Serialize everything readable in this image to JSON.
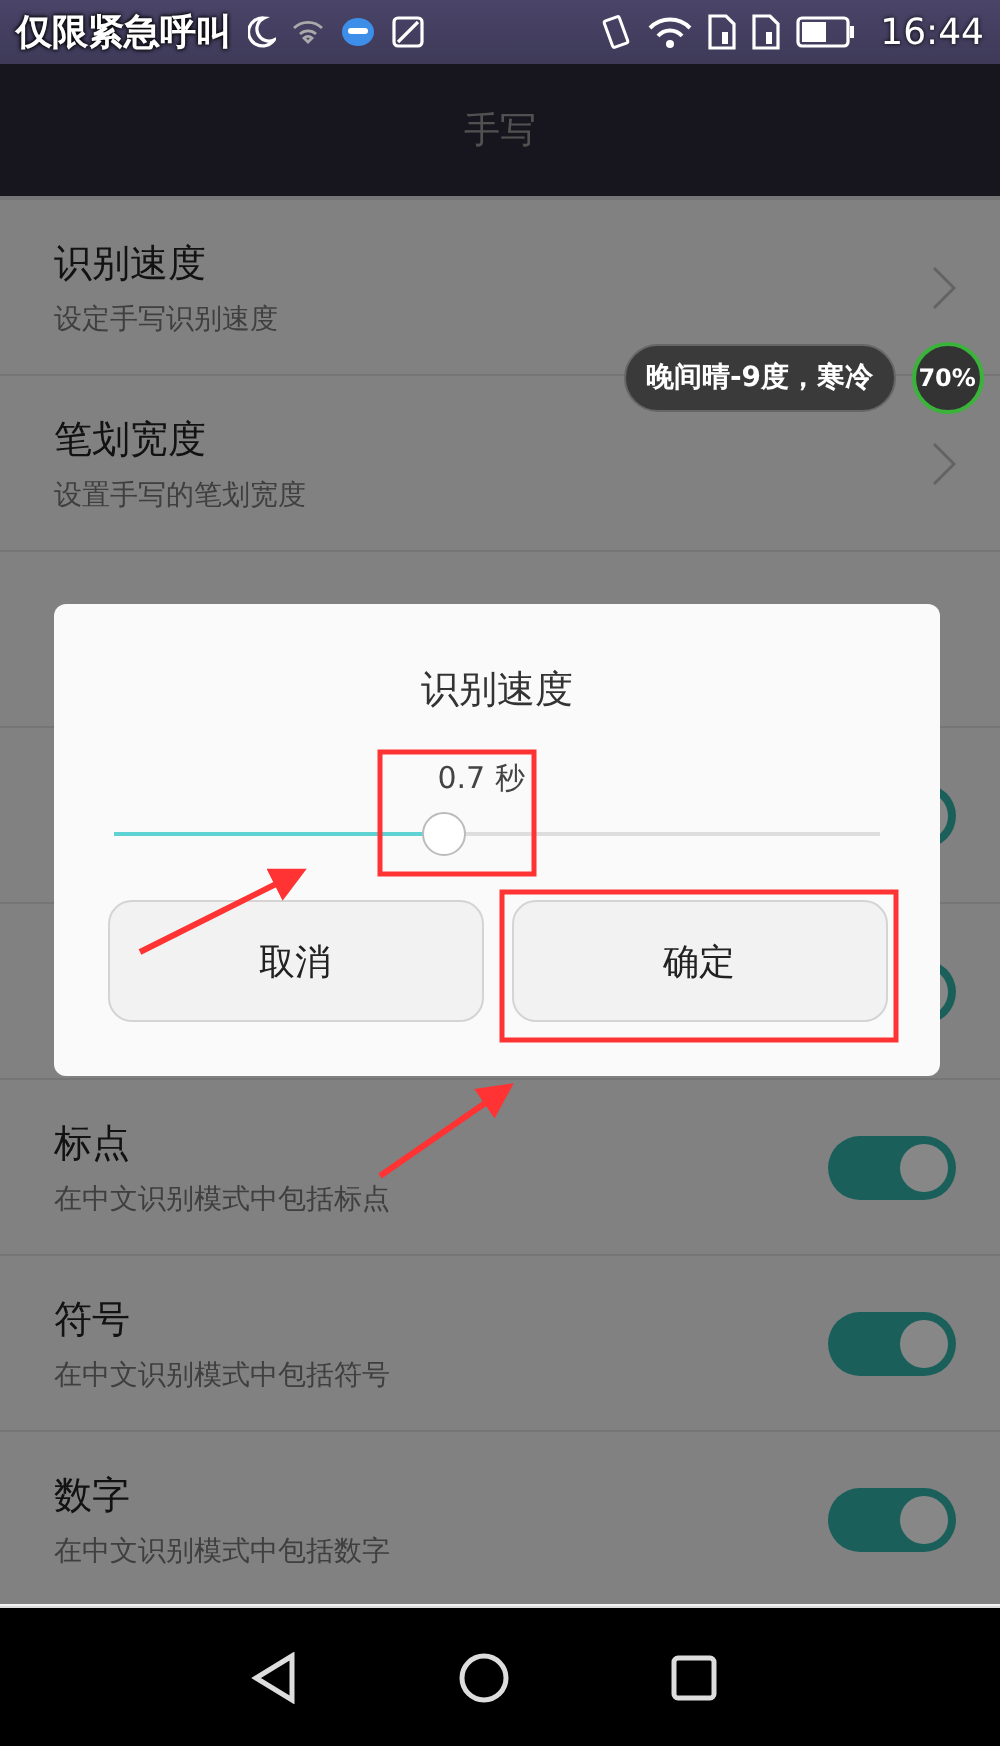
{
  "status_bar": {
    "carrier": "仅限紧急呼叫",
    "time": "16:44"
  },
  "title": "手写",
  "settings": [
    {
      "kind": "chevron",
      "title": "识别速度",
      "subtitle": "设定手写识别速度"
    },
    {
      "kind": "chevron",
      "title": "笔划宽度",
      "subtitle": "设置手写的笔划宽度"
    },
    {
      "kind": "plain"
    },
    {
      "kind": "toggle",
      "on": true
    },
    {
      "kind": "toggle",
      "on": true
    },
    {
      "kind": "toggle",
      "title": "标点",
      "subtitle": "在中文识别模式中包括标点",
      "on": true
    },
    {
      "kind": "toggle",
      "title": "符号",
      "subtitle": "在中文识别模式中包括符号",
      "on": true
    },
    {
      "kind": "toggle",
      "title": "数字",
      "subtitle": "在中文识别模式中包括数字",
      "on": true
    }
  ],
  "weather_widget": {
    "text": "晚间晴-9度，寒冷",
    "percent": "70%"
  },
  "dialog": {
    "title": "识别速度",
    "value": "0.7 秒",
    "level": 0.43,
    "buttons": [
      "取消",
      "确定"
    ]
  }
}
